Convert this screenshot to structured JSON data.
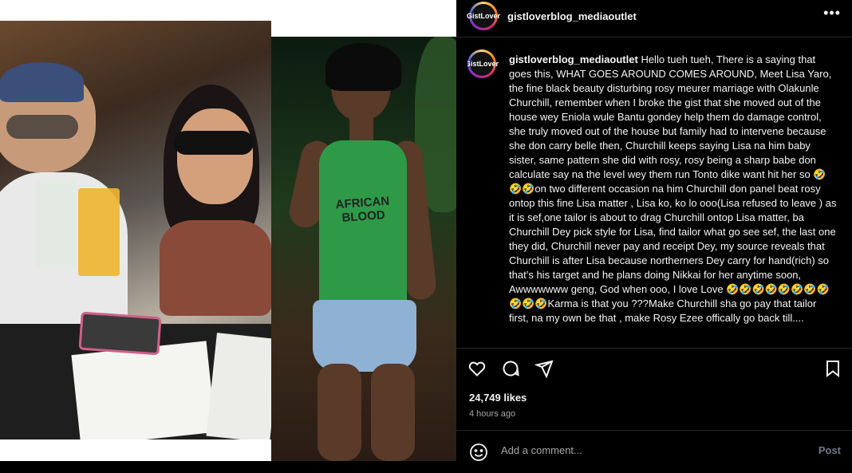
{
  "post": {
    "username": "gistloverblog_mediaoutlet",
    "avatar_label": "GistLover",
    "caption": "Hello tueh tueh, There is a saying that goes this, WHAT GOES AROUND COMES AROUND, Meet Lisa Yaro, the fine black beauty disturbing rosy meurer marriage with Olakunle Churchill, remember when I broke the gist that she moved out of the house wey Eniola wule Bantu gondey help them do damage control, she truly moved out of the house but family had to intervene because she don carry belle then, Churchill keeps saying Lisa na him baby sister, same pattern she did with rosy, rosy being a sharp babe don calculate say na the level wey them run Tonto dike want hit her so 🤣🤣🤣on two different occasion na him Churchill don panel beat rosy ontop this fine Lisa matter , Lisa ko, ko lo ooo(Lisa refused to leave ) as it is sef,one tailor is about to drag Churchill ontop Lisa matter, ba Churchill Dey pick style for Lisa, find tailor what go see sef, the last one they did, Churchill never pay and receipt Dey, my source reveals that Churchill is after Lisa because northerners Dey carry for hand(rich) so that’s his target and he plans doing Nikkai for her anytime soon, Awwwwwww geng, God when ooo, I love Love 🤣🤣🤣🤣🤣🤣🤣🤣🤣🤣🤣Karma is that you ???Make Churchill sha go pay that tailor first, na my own be that , make Rosy Ezee offically go back till....",
    "likes": "24,749 likes",
    "time": "4 hours ago"
  },
  "header": {
    "more_icon": "more-icon",
    "more_label": "•••"
  },
  "media": {
    "shirt_text": "AFRICAN BLOOD"
  },
  "actions": {
    "like_icon": "heart-icon",
    "comment_icon": "comment-icon",
    "share_icon": "share-icon",
    "save_icon": "bookmark-icon"
  },
  "comment_box": {
    "placeholder": "Add a comment...",
    "post_label": "Post",
    "emoji_icon": "emoji-icon"
  },
  "colors": {
    "background": "#000000",
    "text": "#f5f5f5",
    "muted": "#a8a8a8",
    "post_button": "#6b7b8c",
    "divider": "#262626"
  }
}
